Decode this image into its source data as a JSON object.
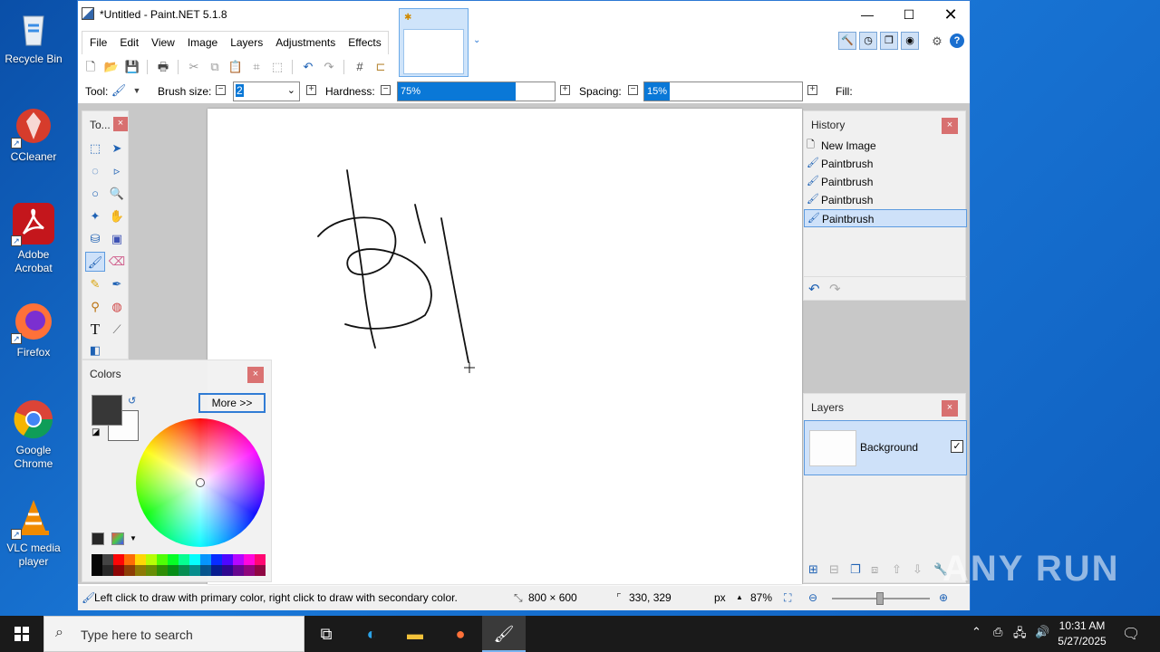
{
  "desktop": {
    "icons": [
      {
        "label": "Recycle Bin",
        "icon": "recycle-bin-icon",
        "color": "#dfe8f2"
      },
      {
        "label": "CCleaner",
        "icon": "ccleaner-icon",
        "color": "#d63c2c"
      },
      {
        "label": "Adobe Acrobat",
        "icon": "adobe-acrobat-icon",
        "color": "#c4161c"
      },
      {
        "label": "Firefox",
        "icon": "firefox-icon",
        "color": "#ff7139"
      },
      {
        "label": "Google Chrome",
        "icon": "chrome-icon",
        "color": "#4285f4"
      },
      {
        "label": "VLC media player",
        "icon": "vlc-icon",
        "color": "#f08a00"
      }
    ]
  },
  "window": {
    "title": "*Untitled - Paint.NET 5.1.8",
    "menu": [
      "File",
      "Edit",
      "View",
      "Image",
      "Layers",
      "Adjustments",
      "Effects"
    ]
  },
  "options": {
    "tool_label": "Tool:",
    "brush_size_label": "Brush size:",
    "brush_size_value": "2",
    "hardness_label": "Hardness:",
    "hardness_value": "75%",
    "hardness_fraction": 0.75,
    "spacing_label": "Spacing:",
    "spacing_value": "15%",
    "spacing_fraction": 0.15,
    "fill_label": "Fill:"
  },
  "tools_panel": {
    "title": "To...",
    "close": "×"
  },
  "colors_panel": {
    "title": "Colors",
    "close": "×",
    "more_button": "More >>",
    "primary_color": "#333333",
    "secondary_color": "#ffffff",
    "palette": [
      "#000000",
      "#404040",
      "#ff0000",
      "#ff6a00",
      "#ffd800",
      "#b6ff00",
      "#4cff00",
      "#00ff21",
      "#00ff90",
      "#00ffff",
      "#0094ff",
      "#0026ff",
      "#4800ff",
      "#b200ff",
      "#ff00dc",
      "#ff006e"
    ]
  },
  "history_panel": {
    "title": "History",
    "close": "×",
    "items": [
      "New Image",
      "Paintbrush",
      "Paintbrush",
      "Paintbrush",
      "Paintbrush"
    ]
  },
  "layers_panel": {
    "title": "Layers",
    "close": "×",
    "layer_name": "Background"
  },
  "statusbar": {
    "hint": "Left click to draw with primary color, right click to draw with secondary color.",
    "image_size": "800 × 600",
    "cursor_pos": "330, 329",
    "unit": "px",
    "zoom": "87%"
  },
  "taskbar": {
    "search_placeholder": "Type here to search",
    "time": "10:31 AM",
    "date": "5/27/2025"
  },
  "watermark": "ANY RUN"
}
